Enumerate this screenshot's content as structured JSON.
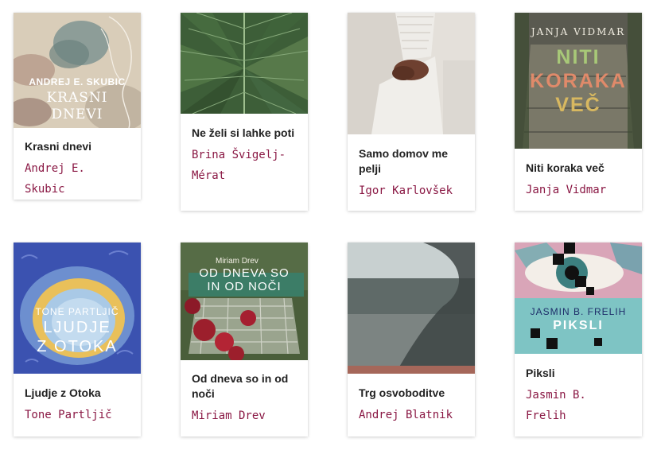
{
  "accent_color": "#8a1844",
  "books": [
    {
      "title": "Krasni dnevi",
      "author": "Andrej E. Skubic",
      "cover_author": "ANDREJ E. SKUBIC",
      "cover_title_1": "KRASNI",
      "cover_title_2": "DNEVI"
    },
    {
      "title": "Ne želi si lahke poti",
      "author": "Brina Švigelj-Mérat"
    },
    {
      "title": "Samo domov me pelji",
      "author": "Igor Karlovšek"
    },
    {
      "title": "Niti koraka več",
      "author": "Janja Vidmar",
      "cover_author": "JANJA VIDMAR",
      "cover_title_1": "NITI",
      "cover_title_2": "KORAKA",
      "cover_title_3": "VEČ"
    },
    {
      "title": "Ljudje z Otoka",
      "author": "Tone Partljič",
      "cover_author": "TONE PARTLJIČ",
      "cover_title_1": "LJUDJE",
      "cover_title_2": "Z OTOKA"
    },
    {
      "title": "Od dneva so in od noči",
      "author": "Miriam Drev",
      "cover_author": "Miriam Drev",
      "cover_title_1": "OD DNEVA SO",
      "cover_title_2": "IN OD NOČI"
    },
    {
      "title": "Trg osvoboditve",
      "author": "Andrej Blatnik"
    },
    {
      "title": "Piksli",
      "author": "Jasmin B. Frelih",
      "cover_author": "JASMIN B. FRELIH",
      "cover_title_1": "PIKSLI"
    }
  ]
}
